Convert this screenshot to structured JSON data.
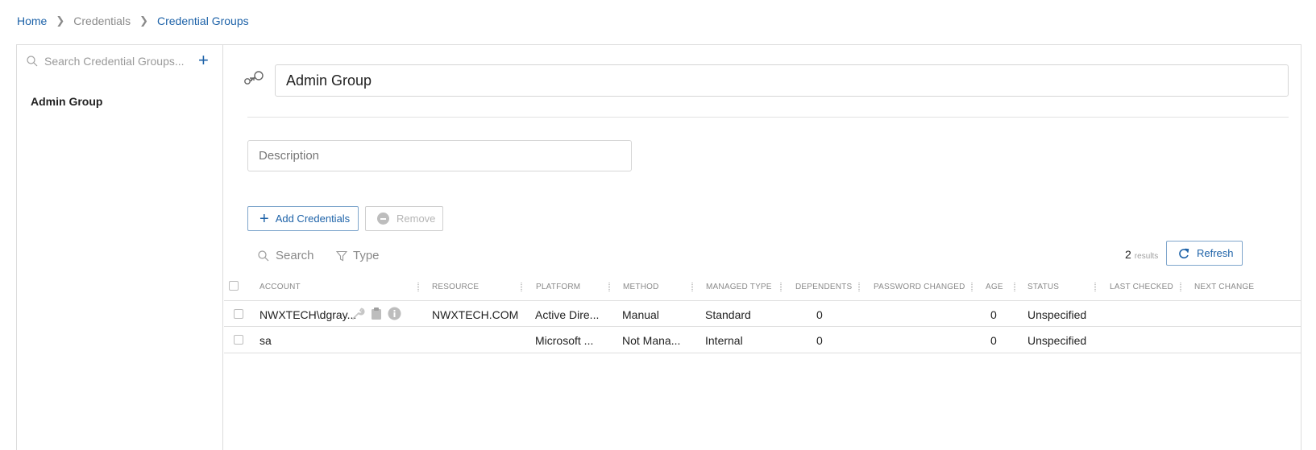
{
  "breadcrumb": {
    "home": "Home",
    "credentials": "Credentials",
    "current": "Credential Groups"
  },
  "sidebar": {
    "search_placeholder": "Search Credential Groups...",
    "add_label": "+",
    "items": [
      {
        "label": "Admin Group"
      }
    ]
  },
  "group": {
    "name": "Admin Group",
    "description_placeholder": "Description"
  },
  "actions": {
    "add_credentials": "Add Credentials",
    "remove": "Remove"
  },
  "filters": {
    "search": "Search",
    "type": "Type"
  },
  "results": {
    "count": "2",
    "label": "results",
    "refresh": "Refresh"
  },
  "table": {
    "columns": {
      "account": "ACCOUNT",
      "resource": "RESOURCE",
      "platform": "PLATFORM",
      "method": "METHOD",
      "managed_type": "MANAGED TYPE",
      "dependents": "DEPENDENTS",
      "password_changed": "PASSWORD CHANGED",
      "age": "AGE",
      "status": "STATUS",
      "last_checked": "LAST CHECKED",
      "next_change": "NEXT CHANGE"
    },
    "rows": [
      {
        "account": "NWXTECH\\dgray...",
        "resource": "NWXTECH.COM",
        "platform": "Active Dire...",
        "method": "Manual",
        "managed_type": "Standard",
        "dependents": "0",
        "password_changed": "",
        "age": "0",
        "status": "Unspecified",
        "last_checked": "",
        "next_change": "",
        "icons": [
          "wrench-icon",
          "clipboard-icon",
          "info-icon"
        ]
      },
      {
        "account": "sa",
        "resource": "",
        "platform": "Microsoft ...",
        "method": "Not Mana...",
        "managed_type": "Internal",
        "dependents": "0",
        "password_changed": "",
        "age": "0",
        "status": "Unspecified",
        "last_checked": "",
        "next_change": ""
      }
    ]
  },
  "colors": {
    "accent": "#1d62a8",
    "muted_text": "#8a8a8a",
    "border": "#dcdcdc"
  }
}
